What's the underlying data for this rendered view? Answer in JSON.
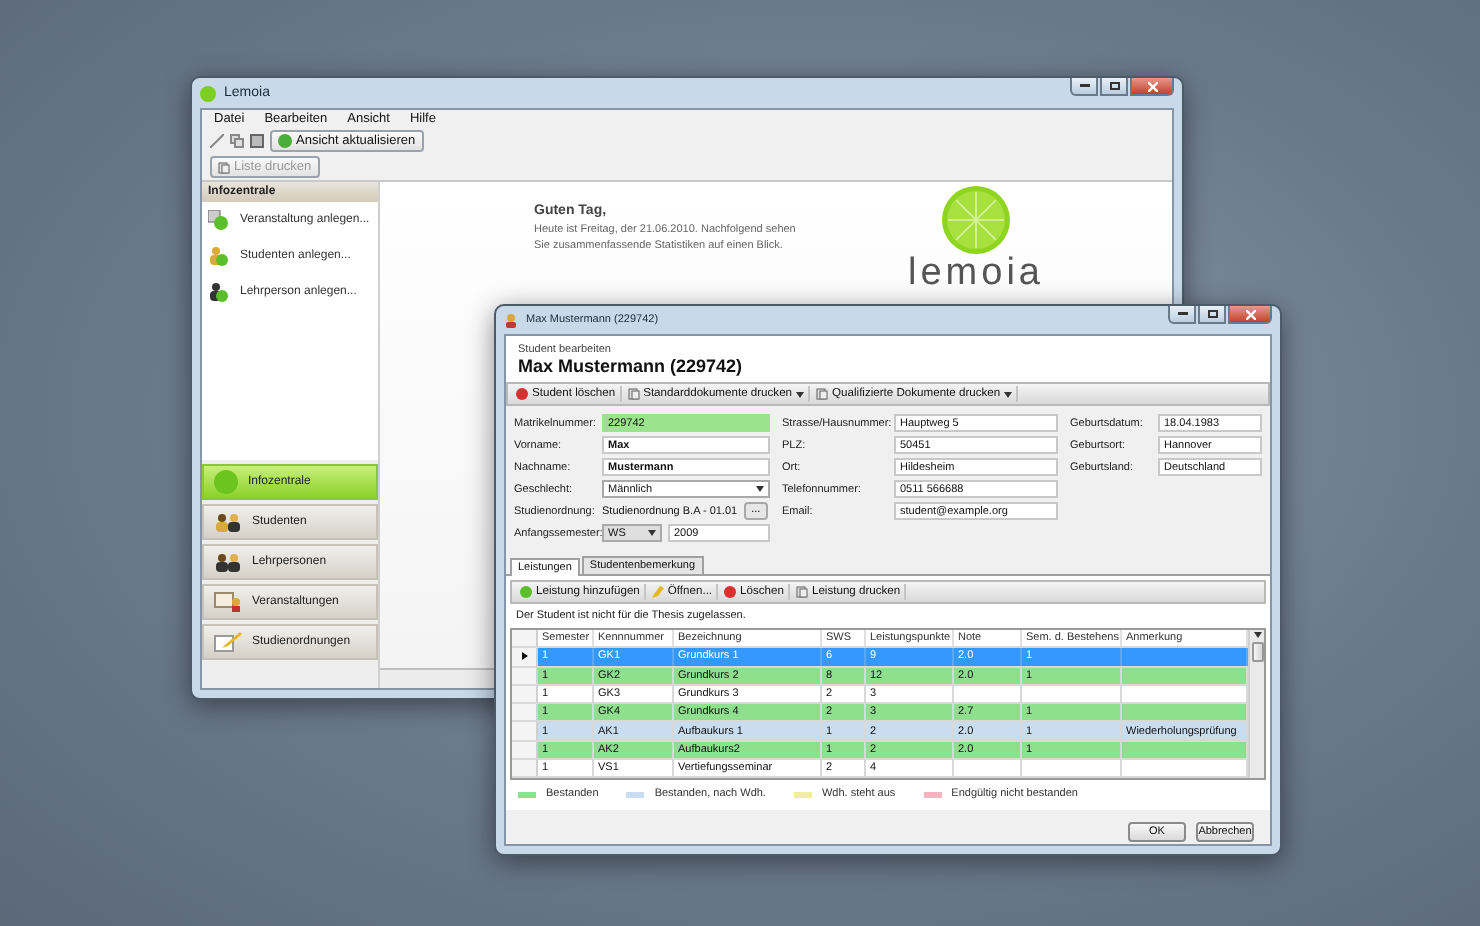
{
  "back_window": {
    "title": "Lemoia",
    "menu": [
      "Datei",
      "Bearbeiten",
      "Ansicht",
      "Hilfe"
    ],
    "refresh_button": "Ansicht aktualisieren",
    "print_button": {
      "label": "Liste drucken",
      "disabled": true
    },
    "sidebar": {
      "header": "Infozentrale",
      "actions": [
        "Veranstaltung anlegen...",
        "Studenten anlegen...",
        "Lehrperson anlegen..."
      ],
      "nav": [
        {
          "label": "Infozentrale",
          "selected": true
        },
        {
          "label": "Studenten",
          "selected": false
        },
        {
          "label": "Lehrpersonen",
          "selected": false
        },
        {
          "label": "Veranstaltungen",
          "selected": false
        },
        {
          "label": "Studienordnungen",
          "selected": false
        }
      ]
    },
    "welcome": {
      "title": "Guten Tag,",
      "text": "Heute ist Freitag, der 21.06.2010. Nachfolgend sehen\nSie zusammenfassende Statistiken auf einen Blick."
    },
    "logo_text": "lemoia"
  },
  "front_window": {
    "title": "Max Mustermann (229742)",
    "subtitle": "Student bearbeiten",
    "heading": "Max Mustermann (229742)",
    "toolbar": [
      {
        "label": "Student löschen",
        "kind": "delete"
      },
      {
        "label": "Standarddokumente drucken",
        "kind": "dropdown"
      },
      {
        "label": "Qualifizierte Dokumente drucken",
        "kind": "dropdown"
      }
    ],
    "form_columns": [
      [
        {
          "label": "Matrikelnummer:",
          "value": "229742",
          "kind": "readonly"
        },
        {
          "label": "Vorname:",
          "value": "Max",
          "kind": "name"
        },
        {
          "label": "Nachname:",
          "value": "Mustermann",
          "kind": "name"
        },
        {
          "label": "Geschlecht:",
          "value": "Männlich",
          "kind": "select"
        },
        {
          "label": "Studienordnung:",
          "value": "Studienordnung B.A - 01.01",
          "kind": "browse",
          "button": "..."
        },
        {
          "label": "Anfangssemester:",
          "value": "WS",
          "extra": "2009",
          "kind": "semester"
        }
      ],
      [
        {
          "label": "Strasse/Hausnummer:",
          "value": "Hauptweg 5",
          "kind": "text"
        },
        {
          "label": "PLZ:",
          "value": "50451",
          "kind": "text"
        },
        {
          "label": "Ort:",
          "value": "Hildesheim",
          "kind": "text"
        },
        {
          "label": "Telefonnummer:",
          "value": "0511 566688",
          "kind": "text"
        },
        {
          "label": "Email:",
          "value": "student@example.org",
          "kind": "text"
        }
      ],
      [
        {
          "label": "Geburtsdatum:",
          "value": "18.04.1983",
          "kind": "text"
        },
        {
          "label": "Geburtsort:",
          "value": "Hannover",
          "kind": "text"
        },
        {
          "label": "Geburtsland:",
          "value": "Deutschland",
          "kind": "text"
        }
      ]
    ],
    "tabs": [
      {
        "label": "Leistungen",
        "selected": true
      },
      {
        "label": "Studentenbemerkung",
        "selected": false
      }
    ],
    "tab_toolbar": [
      {
        "label": "Leistung hinzufügen",
        "kind": "add"
      },
      {
        "label": "Öffnen...",
        "kind": "edit"
      },
      {
        "label": "Löschen",
        "kind": "delete"
      },
      {
        "label": "Leistung drucken",
        "kind": "print"
      }
    ],
    "notice": "Der Student ist nicht für die Thesis zugelassen.",
    "table": {
      "columns": [
        "Semester",
        "Kennnummer",
        "Bezeichnung",
        "SWS",
        "Leistungspunkte",
        "Note",
        "Sem. d. Bestehens",
        "Anmerkung"
      ],
      "rows": [
        {
          "cells": [
            "1",
            "GK1",
            "Grundkurs 1",
            "6",
            "9",
            "2.0",
            "1",
            ""
          ],
          "kind": "passed",
          "selected": true
        },
        {
          "cells": [
            "1",
            "GK2",
            "Grundkurs 2",
            "8",
            "12",
            "2.0",
            "1",
            ""
          ],
          "kind": "passed",
          "selected": false
        },
        {
          "cells": [
            "1",
            "GK3",
            "Grundkurs 3",
            "2",
            "3",
            "",
            "",
            ""
          ],
          "kind": "none",
          "selected": false
        },
        {
          "cells": [
            "1",
            "GK4",
            "Grundkurs 4",
            "2",
            "3",
            "2.7",
            "1",
            ""
          ],
          "kind": "passed",
          "selected": false
        },
        {
          "cells": [
            "1",
            "AK1",
            "Aufbaukurs 1",
            "1",
            "2",
            "2.0",
            "1",
            "Wiederholungsprüfung"
          ],
          "kind": "retake",
          "selected": false
        },
        {
          "cells": [
            "1",
            "AK2",
            "Aufbaukurs2",
            "1",
            "2",
            "2.0",
            "1",
            ""
          ],
          "kind": "passed",
          "selected": false
        },
        {
          "cells": [
            "1",
            "VS1",
            "Vertiefungsseminar",
            "2",
            "4",
            "",
            "",
            ""
          ],
          "kind": "none",
          "selected": false
        }
      ]
    },
    "legend": [
      {
        "label": "Bestanden",
        "kind": "passed",
        "color": "#8ee08e"
      },
      {
        "label": "Bestanden, nach Wdh.",
        "kind": "retake",
        "color": "#c9ddf0"
      },
      {
        "label": "Wdh. steht aus",
        "kind": "pending",
        "color": "#f3ee9a"
      },
      {
        "label": "Endgültig nicht bestanden",
        "kind": "failed",
        "color": "#f3b3bf"
      }
    ],
    "buttons": [
      "OK",
      "Abbrechen"
    ]
  }
}
